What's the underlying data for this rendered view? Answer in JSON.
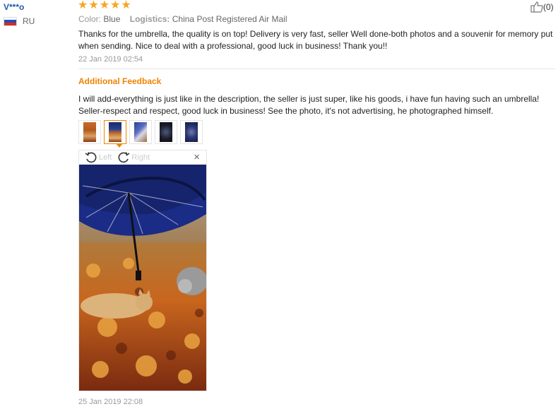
{
  "reviewer": {
    "name": "V***o",
    "country": "RU"
  },
  "rating": 5,
  "order": {
    "color_label": "Color:",
    "color_value": "Blue",
    "logistics_label": "Logistics:",
    "logistics_value": "China Post Registered Air Mail"
  },
  "helpful": {
    "count": "(0)"
  },
  "review": {
    "text": "Thanks for the umbrella, the quality is on top! Delivery is very fast, seller Well done-both photos and a souvenir for memory put when sending. Nice to deal with a professional, good luck in business! Thank you!!",
    "date": "22 Jan 2019 02:54"
  },
  "additional": {
    "heading": "Additional Feedback",
    "text": "I will add-everything is just like in the description, the seller is just super, like his goods, i have fun having such an umbrella! Seller-respect and respect, good luck in business! See the photo, it's not advertising, he photographed himself.",
    "date": "25 Jan 2019 22:08"
  },
  "viewer": {
    "rotate_left": "Left",
    "rotate_right": "Right",
    "close": "×"
  },
  "colors": {
    "link": "#1c5fa8",
    "accent": "#f08300",
    "star": "#f5a623"
  }
}
